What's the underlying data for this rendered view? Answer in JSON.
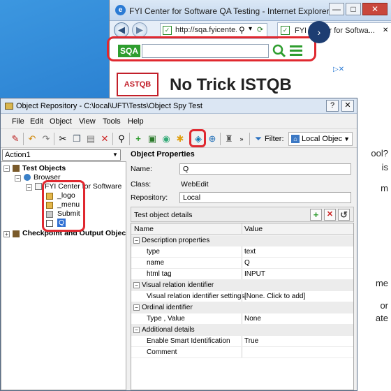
{
  "browser": {
    "title": "FYI Center for Software QA Testing - Internet Explorer",
    "address": "http://sqa.fyicente...",
    "tab_label": "FYI Center for Softwa...",
    "controls": {
      "minimize": "—",
      "maximize": "□",
      "close": "✕"
    },
    "back_symbol": "◀",
    "forward_symbol": "▶",
    "nav_icons": {
      "dropdown": "▾",
      "search": "⚲",
      "refresh": "⟳",
      "close_tab": "✕"
    }
  },
  "sqa_bar": {
    "logo_text": "SQA",
    "search_value": ""
  },
  "ad": {
    "logo_text": "ASTQB",
    "headline": "No Trick ISTQB",
    "choices": "▷✕",
    "arrow": "›"
  },
  "page_peek": [
    "ool?",
    "is",
    "m",
    "me",
    "or",
    "ate"
  ],
  "object_repository": {
    "title": "Object Repository - C:\\local\\UFT\\Tests\\Object Spy Test",
    "controls": {
      "help": "?",
      "close": "✕"
    },
    "menu": [
      "File",
      "Edit",
      "Object",
      "View",
      "Tools",
      "Help"
    ],
    "toolbar_icons": [
      "find-icon",
      "undo-icon",
      "redo-icon",
      "cut-icon",
      "copy-icon",
      "paste-icon",
      "delete-icon",
      "search-icon",
      "add-object-icon",
      "add-insight-icon",
      "object-spy-icon",
      "highlight-icon",
      "navigate-highlight-icon",
      "show-in-app-icon",
      "object-icon",
      "more-icon"
    ],
    "filter_label": "Filter:",
    "filter_value": "Local Objec",
    "action": "Action1",
    "tree": {
      "root": "Test Objects",
      "browser": "Browser",
      "page": "FYI Center for Software",
      "leaves": [
        "_logo",
        "_menu",
        "Submit",
        "Q"
      ],
      "checkpoints": "Checkpoint and Output Objec"
    },
    "properties_header": "Object Properties",
    "fields": {
      "name_label": "Name:",
      "name_value": "Q",
      "class_label": "Class:",
      "class_value": "WebEdit",
      "repository_label": "Repository:",
      "repository_value": "Local"
    },
    "details": {
      "title": "Test object details",
      "buttons": {
        "add": "+",
        "remove": "✕",
        "refresh": "↺"
      },
      "columns": [
        "Name",
        "Value"
      ],
      "rows": [
        {
          "kind": "category",
          "name": "Description properties"
        },
        {
          "kind": "prop",
          "name": "type",
          "value": "text"
        },
        {
          "kind": "prop",
          "name": "name",
          "value": "Q"
        },
        {
          "kind": "prop",
          "name": "html tag",
          "value": "INPUT"
        },
        {
          "kind": "category",
          "name": "Visual relation identifier"
        },
        {
          "kind": "prop",
          "name": "Visual relation identifier settings",
          "value": "[None. Click to add]"
        },
        {
          "kind": "category",
          "name": "Ordinal identifier"
        },
        {
          "kind": "prop",
          "name": "Type , Value",
          "value": "None"
        },
        {
          "kind": "category",
          "name": "Additional details"
        },
        {
          "kind": "prop",
          "name": "Enable Smart Identification",
          "value": "True"
        },
        {
          "kind": "prop",
          "name": "Comment",
          "value": ""
        }
      ]
    }
  },
  "colors": {
    "highlight": "#e0282f",
    "sqa_green": "#2e9d2e",
    "desktop": "#1f72c8"
  }
}
